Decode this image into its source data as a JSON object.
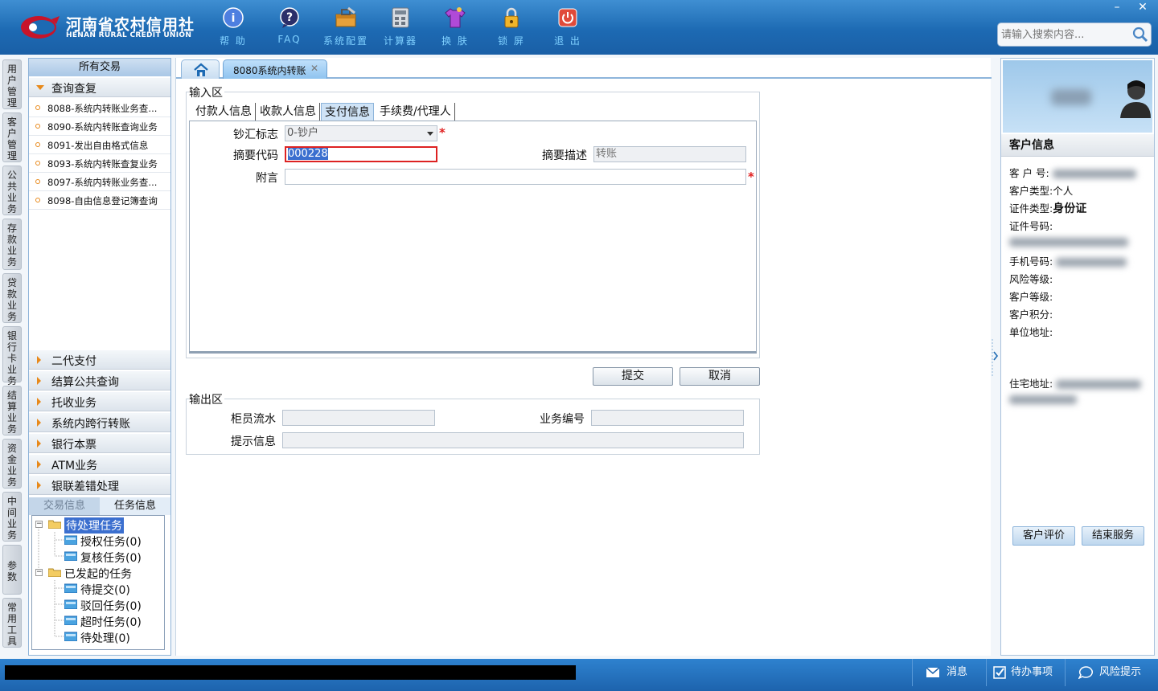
{
  "header": {
    "brand_cn": "河南省农村信用社",
    "brand_en": "HENAN RURAL CREDIT UNION",
    "tools": [
      {
        "label": "帮 助",
        "icon": "help-icon"
      },
      {
        "label": "FAQ",
        "icon": "faq-icon"
      },
      {
        "label": "系统配置",
        "icon": "toolbox-icon"
      },
      {
        "label": "计算器",
        "icon": "calculator-icon"
      },
      {
        "label": "换 肤",
        "icon": "tshirt-icon"
      },
      {
        "label": "锁 屏",
        "icon": "lock-icon"
      },
      {
        "label": "退 出",
        "icon": "power-icon"
      }
    ],
    "search_placeholder": "请输入搜索内容...",
    "minimize": "–",
    "close": "✕"
  },
  "vertical_tabs": [
    "用户管理",
    "客户管理",
    "公共业务",
    "存款业务",
    "贷款业务",
    "银行卡业务",
    "结算业务",
    "资金业务",
    "中间业务",
    "参数",
    "常用工具"
  ],
  "left_panel": {
    "title": "所有交易",
    "open_section": "查询查复",
    "open_items": [
      "8088-系统内转账业务查...",
      "8090-系统内转账查询业务",
      "8091-发出自由格式信息",
      "8093-系统内转账查复业务",
      "8097-系统内转账业务查...",
      "8098-自由信息登记簿查询"
    ],
    "sections": [
      "二代支付",
      "结算公共查询",
      "托收业务",
      "系统内跨行转账",
      "银行本票",
      "ATM业务",
      "银联差错处理"
    ],
    "bottom_tabs": [
      "交易信息",
      "任务信息"
    ],
    "tree": {
      "pending": {
        "label": "待处理任务",
        "children": [
          "授权任务(0)",
          "复核任务(0)"
        ]
      },
      "initiated": {
        "label": "已发起的任务",
        "children": [
          "待提交(0)",
          "驳回任务(0)",
          "超时任务(0)",
          "待处理(0)"
        ]
      }
    }
  },
  "main": {
    "active_tab": "8080系统内转账",
    "input_area": {
      "legend": "输入区",
      "tabs": [
        "付款人信息",
        "收款人信息",
        "支付信息",
        "手续费/代理人"
      ],
      "active_tab_index": 2,
      "fields": {
        "cash_flag": {
          "label": "钞汇标志",
          "value": "0-钞户"
        },
        "summary_code": {
          "label": "摘要代码",
          "value": "000228"
        },
        "summary_desc": {
          "label": "摘要描述",
          "value": "转账"
        },
        "postscript": {
          "label": "附言",
          "value": ""
        }
      },
      "required_mark": "*"
    },
    "buttons": {
      "submit": "提交",
      "cancel": "取消"
    },
    "output_area": {
      "legend": "输出区",
      "fields": {
        "teller_serial": {
          "label": "柜员流水",
          "value": ""
        },
        "business_no": {
          "label": "业务编号",
          "value": ""
        },
        "prompt_info": {
          "label": "提示信息",
          "value": ""
        }
      }
    }
  },
  "customer": {
    "title": "客户信息",
    "fields": [
      {
        "label": "客 户 号:",
        "value": ""
      },
      {
        "label": "客户类型:",
        "value": "个人"
      },
      {
        "label": "证件类型:",
        "value": "身份证"
      },
      {
        "label": "证件号码:",
        "value": ""
      },
      {
        "label": "手机号码:",
        "value": ""
      },
      {
        "label": "风险等级:",
        "value": ""
      },
      {
        "label": "客户等级:",
        "value": ""
      },
      {
        "label": "客户积分:",
        "value": ""
      },
      {
        "label": "单位地址:",
        "value": ""
      },
      {
        "label": "住宅地址:",
        "value": ""
      }
    ],
    "buttons": {
      "evaluate": "客户评价",
      "end_service": "结束服务"
    }
  },
  "status_bar": {
    "message": "消息",
    "todo": "待办事项",
    "risk": "风险提示"
  },
  "colors": {
    "header_blue": "#1d6ab3",
    "tool_label": "#7fd0ff",
    "accent_orange": "#e8891a",
    "required_red": "#e02020",
    "selected_tree": "#3b6fcf"
  }
}
